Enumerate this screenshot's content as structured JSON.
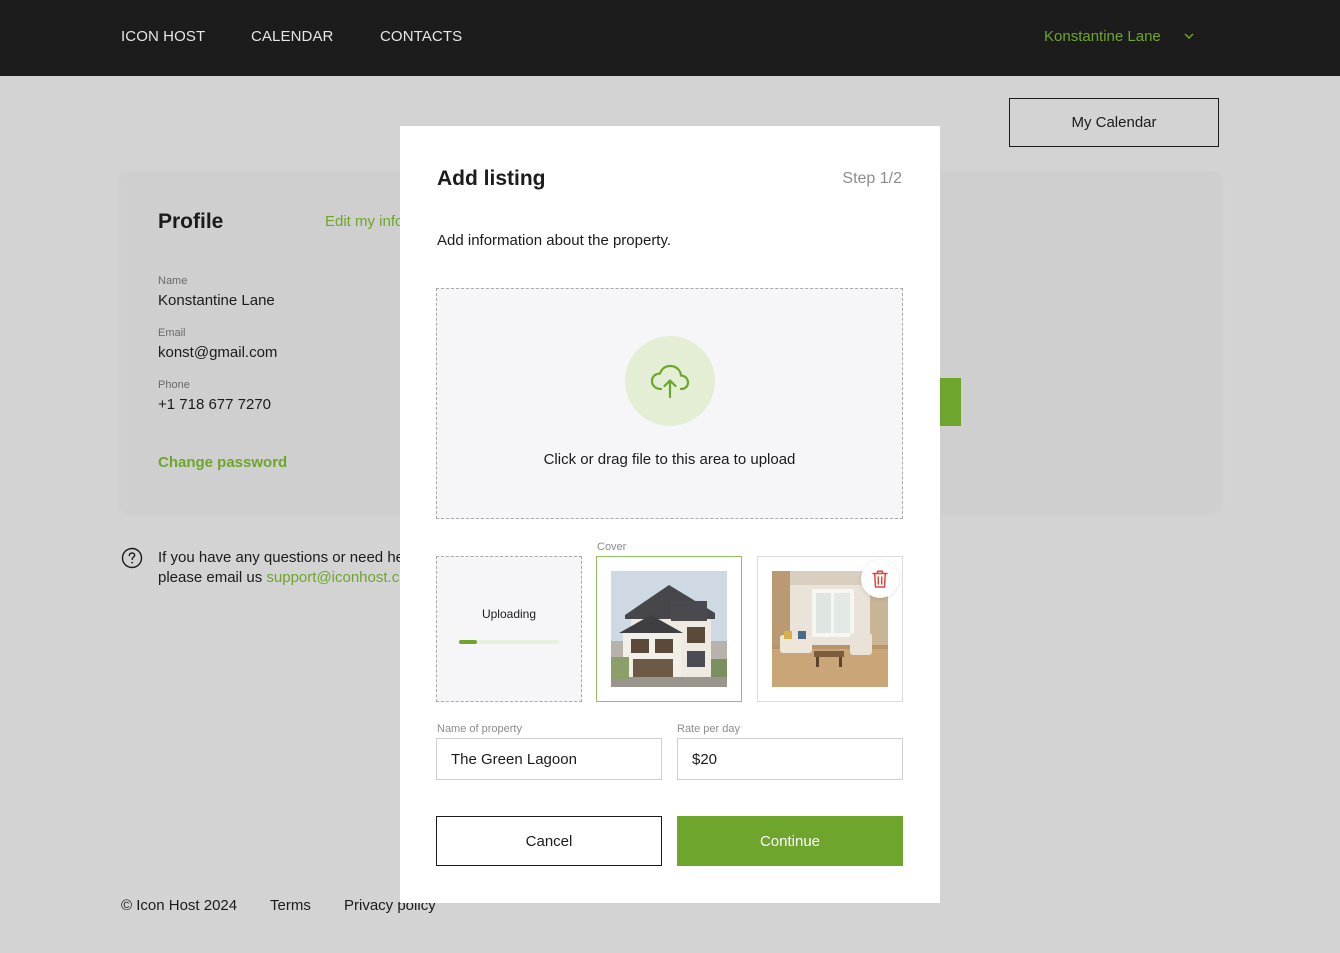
{
  "nav": {
    "links": [
      "ICON HOST",
      "CALENDAR",
      "CONTACTS"
    ],
    "user": "Konstantine Lane",
    "user_menu_icon": "chevron-down-icon"
  },
  "page": {
    "calendar_button": "My Calendar",
    "profile": {
      "title": "Profile",
      "edit_link": "Edit my information",
      "fields": [
        {
          "label": "Name",
          "value": "Konstantine Lane"
        },
        {
          "label": "Email",
          "value": "konst@gmail.com"
        },
        {
          "label": "Phone",
          "value": "+1 718 677 7270"
        }
      ],
      "change_password": "Change password"
    },
    "help": {
      "icon": "question-circle-icon",
      "line1": "If you have any questions or need help,",
      "line2_prefix": "please email us ",
      "email": "support@iconhost.com"
    },
    "footer": [
      "© Icon Host 2024",
      "Terms",
      "Privacy policy"
    ]
  },
  "modal": {
    "title": "Add listing",
    "step": "Step 1/2",
    "description": "Add information about the property.",
    "dropzone": {
      "icon": "cloud-upload-icon",
      "text": "Click or drag file to this area to upload"
    },
    "thumbnails": {
      "uploading_text": "Uploading",
      "upload_progress": 0.18,
      "cover_label": "Cover",
      "delete_icon": "trash-icon"
    },
    "fields": {
      "name_label": "Name of property",
      "name_value": "The Green Lagoon",
      "rate_label": "Rate per day",
      "rate_value": "$20"
    },
    "cancel_label": "Cancel",
    "continue_label": "Continue"
  },
  "colors": {
    "accent": "#6ea52d",
    "nav_bg": "#1c1c1c",
    "overlay_bg": "#d3d3d3",
    "delete": "#e0443e"
  }
}
